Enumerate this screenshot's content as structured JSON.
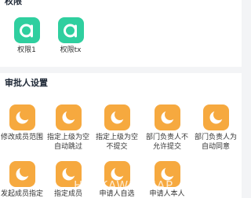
{
  "sections": [
    {
      "title": "权限",
      "items": [
        {
          "label": "权限1",
          "icon": "app-a-icon"
        },
        {
          "label": "权限tx",
          "icon": "app-a-icon"
        }
      ]
    },
    {
      "title": "审批人设置",
      "items": [
        {
          "label": "修改成员范围",
          "icon": "moon-icon"
        },
        {
          "label": "指定上级为空\n自动跳过",
          "icon": "moon-icon"
        },
        {
          "label": "指定上级为空\n不提交",
          "icon": "moon-icon"
        },
        {
          "label": "部门负责人不\n允许提交",
          "icon": "moon-icon"
        },
        {
          "label": "部门负责人为\n自动同意",
          "icon": "moon-icon"
        },
        {
          "label": "发起成员指定",
          "icon": "moon-icon"
        },
        {
          "label": "指定成员",
          "icon": "moon-icon"
        },
        {
          "label": "申请人自选",
          "icon": "moon-icon"
        },
        {
          "label": "申请人本人",
          "icon": "moon-icon"
        }
      ]
    }
  ],
  "watermark": "HCFKAWEI MAP",
  "colors": {
    "green_icon": "#2fcf9f",
    "orange_icon": "#f6a93f",
    "page_background": "#f3f4f6"
  }
}
